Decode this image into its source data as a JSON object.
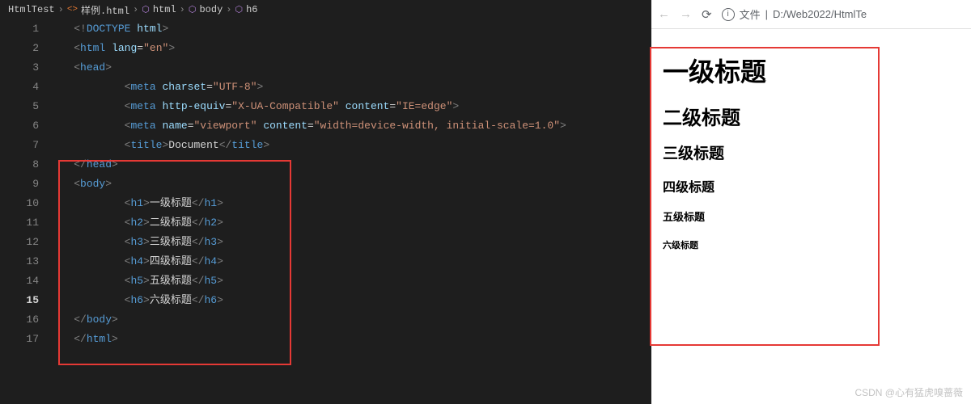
{
  "breadcrumb": {
    "root": "HtmlTest",
    "file": "样例.html",
    "path": [
      "html",
      "body",
      "h6"
    ]
  },
  "code_lines": [
    {
      "n": 1,
      "indent": 1,
      "segs": [
        [
          "p-gray",
          "<!"
        ],
        [
          "p-blue",
          "DOCTYPE"
        ],
        [
          "p-text",
          " "
        ],
        [
          "p-attr",
          "html"
        ],
        [
          "p-gray",
          ">"
        ]
      ]
    },
    {
      "n": 2,
      "indent": 1,
      "segs": [
        [
          "p-gray",
          "<"
        ],
        [
          "p-blue",
          "html"
        ],
        [
          "p-text",
          " "
        ],
        [
          "p-attr",
          "lang"
        ],
        [
          "p-text",
          "="
        ],
        [
          "p-str",
          "\"en\""
        ],
        [
          "p-gray",
          ">"
        ]
      ]
    },
    {
      "n": 3,
      "indent": 1,
      "segs": [
        [
          "p-gray",
          "<"
        ],
        [
          "p-blue",
          "head"
        ],
        [
          "p-gray",
          ">"
        ]
      ]
    },
    {
      "n": 4,
      "indent": 3,
      "segs": [
        [
          "p-gray",
          "<"
        ],
        [
          "p-blue",
          "meta"
        ],
        [
          "p-text",
          " "
        ],
        [
          "p-attr",
          "charset"
        ],
        [
          "p-text",
          "="
        ],
        [
          "p-str",
          "\"UTF-8\""
        ],
        [
          "p-gray",
          ">"
        ]
      ]
    },
    {
      "n": 5,
      "indent": 3,
      "segs": [
        [
          "p-gray",
          "<"
        ],
        [
          "p-blue",
          "meta"
        ],
        [
          "p-text",
          " "
        ],
        [
          "p-attr",
          "http-equiv"
        ],
        [
          "p-text",
          "="
        ],
        [
          "p-str",
          "\"X-UA-Compatible\""
        ],
        [
          "p-text",
          " "
        ],
        [
          "p-attr",
          "content"
        ],
        [
          "p-text",
          "="
        ],
        [
          "p-str",
          "\"IE=edge\""
        ],
        [
          "p-gray",
          ">"
        ]
      ]
    },
    {
      "n": 6,
      "indent": 3,
      "segs": [
        [
          "p-gray",
          "<"
        ],
        [
          "p-blue",
          "meta"
        ],
        [
          "p-text",
          " "
        ],
        [
          "p-attr",
          "name"
        ],
        [
          "p-text",
          "="
        ],
        [
          "p-str",
          "\"viewport\""
        ],
        [
          "p-text",
          " "
        ],
        [
          "p-attr",
          "content"
        ],
        [
          "p-text",
          "="
        ],
        [
          "p-str",
          "\"width=device-width, initial-scale=1.0\""
        ],
        [
          "p-gray",
          ">"
        ]
      ]
    },
    {
      "n": 7,
      "indent": 3,
      "segs": [
        [
          "p-gray",
          "<"
        ],
        [
          "p-blue",
          "title"
        ],
        [
          "p-gray",
          ">"
        ],
        [
          "p-text",
          "Document"
        ],
        [
          "p-gray",
          "</"
        ],
        [
          "p-blue",
          "title"
        ],
        [
          "p-gray",
          ">"
        ]
      ]
    },
    {
      "n": 8,
      "indent": 1,
      "segs": [
        [
          "p-gray",
          "</"
        ],
        [
          "p-blue",
          "head"
        ],
        [
          "p-gray",
          ">"
        ]
      ]
    },
    {
      "n": 9,
      "indent": 1,
      "segs": [
        [
          "p-gray",
          "<"
        ],
        [
          "p-blue",
          "body"
        ],
        [
          "p-gray",
          ">"
        ]
      ]
    },
    {
      "n": 10,
      "indent": 3,
      "segs": [
        [
          "p-gray",
          "<"
        ],
        [
          "p-blue",
          "h1"
        ],
        [
          "p-gray",
          ">"
        ],
        [
          "p-text",
          "一级标题"
        ],
        [
          "p-gray",
          "</"
        ],
        [
          "p-blue",
          "h1"
        ],
        [
          "p-gray",
          ">"
        ]
      ]
    },
    {
      "n": 11,
      "indent": 3,
      "segs": [
        [
          "p-gray",
          "<"
        ],
        [
          "p-blue",
          "h2"
        ],
        [
          "p-gray",
          ">"
        ],
        [
          "p-text",
          "二级标题"
        ],
        [
          "p-gray",
          "</"
        ],
        [
          "p-blue",
          "h2"
        ],
        [
          "p-gray",
          ">"
        ]
      ]
    },
    {
      "n": 12,
      "indent": 3,
      "segs": [
        [
          "p-gray",
          "<"
        ],
        [
          "p-blue",
          "h3"
        ],
        [
          "p-gray",
          ">"
        ],
        [
          "p-text",
          "三级标题"
        ],
        [
          "p-gray",
          "</"
        ],
        [
          "p-blue",
          "h3"
        ],
        [
          "p-gray",
          ">"
        ]
      ]
    },
    {
      "n": 13,
      "indent": 3,
      "segs": [
        [
          "p-gray",
          "<"
        ],
        [
          "p-blue",
          "h4"
        ],
        [
          "p-gray",
          ">"
        ],
        [
          "p-text",
          "四级标题"
        ],
        [
          "p-gray",
          "</"
        ],
        [
          "p-blue",
          "h4"
        ],
        [
          "p-gray",
          ">"
        ]
      ]
    },
    {
      "n": 14,
      "indent": 3,
      "segs": [
        [
          "p-gray",
          "<"
        ],
        [
          "p-blue",
          "h5"
        ],
        [
          "p-gray",
          ">"
        ],
        [
          "p-text",
          "五级标题"
        ],
        [
          "p-gray",
          "</"
        ],
        [
          "p-blue",
          "h5"
        ],
        [
          "p-gray",
          ">"
        ]
      ]
    },
    {
      "n": 15,
      "indent": 3,
      "current": true,
      "segs": [
        [
          "p-gray",
          "<"
        ],
        [
          "p-blue",
          "h6"
        ],
        [
          "p-gray",
          ">"
        ],
        [
          "p-text",
          "六级标题"
        ],
        [
          "p-gray",
          "</"
        ],
        [
          "p-blue",
          "h6"
        ],
        [
          "p-gray",
          ">"
        ]
      ]
    },
    {
      "n": 16,
      "indent": 1,
      "segs": [
        [
          "p-gray",
          "</"
        ],
        [
          "p-blue",
          "body"
        ],
        [
          "p-gray",
          ">"
        ]
      ]
    },
    {
      "n": 17,
      "indent": 1,
      "segs": [
        [
          "p-gray",
          "</"
        ],
        [
          "p-blue",
          "html"
        ],
        [
          "p-gray",
          ">"
        ]
      ]
    }
  ],
  "browser": {
    "url_prefix": "文件",
    "url_path": "D:/Web2022/HtmlTe",
    "headings": [
      "一级标题",
      "二级标题",
      "三级标题",
      "四级标题",
      "五级标题",
      "六级标题"
    ]
  },
  "watermark": "CSDN @心有猛虎嗅蔷薇"
}
